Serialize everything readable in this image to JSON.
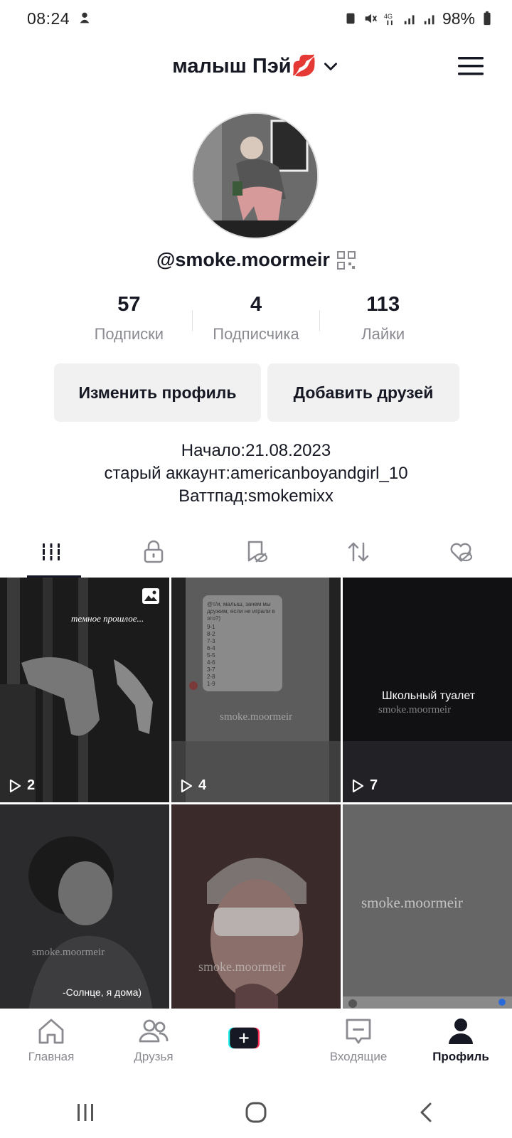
{
  "status_bar": {
    "time": "08:24",
    "battery": "98%"
  },
  "header": {
    "profile_name": "малыш Пэй💋"
  },
  "profile": {
    "username": "@smoke.moormeir",
    "stats": [
      {
        "value": "57",
        "label": "Подписки"
      },
      {
        "value": "4",
        "label": "Подписчика"
      },
      {
        "value": "113",
        "label": "Лайки"
      }
    ],
    "edit_button": "Изменить профиль",
    "add_friends_button": "Добавить друзей",
    "bio": [
      "Начало:21.08.2023",
      "старый аккаунт:americanboyandgirl_10",
      "Ваттпад:smokemixx"
    ]
  },
  "tabs": [
    {
      "icon": "videos-grid-icon",
      "active": true
    },
    {
      "icon": "lock-icon",
      "active": false
    },
    {
      "icon": "bookmark-hidden-icon",
      "active": false
    },
    {
      "icon": "repost-icon",
      "active": false
    },
    {
      "icon": "heart-hidden-icon",
      "active": false
    }
  ],
  "videos": [
    {
      "views": "2",
      "caption": "темное прошлое...",
      "has_photo_icon": true
    },
    {
      "views": "4",
      "watermark": "smoke.moormeir"
    },
    {
      "views": "7",
      "title": "Школьный туалет",
      "watermark": "smoke.moormeir"
    },
    {
      "views": "",
      "watermark": "smoke.moormeir",
      "caption": "-Солнце, я дома)"
    },
    {
      "views": "",
      "watermark": "smoke.moormeir"
    },
    {
      "views": "",
      "watermark": "smoke.moormeir"
    }
  ],
  "bottom_nav": {
    "home": "Главная",
    "friends": "Друзья",
    "inbox": "Входящие",
    "profile": "Профиль"
  },
  "colors": {
    "text_primary": "#161823",
    "text_secondary": "#8a8b91",
    "button_bg": "#f1f1f2",
    "create_cyan": "#25f4ee",
    "create_pink": "#fe2c55"
  }
}
